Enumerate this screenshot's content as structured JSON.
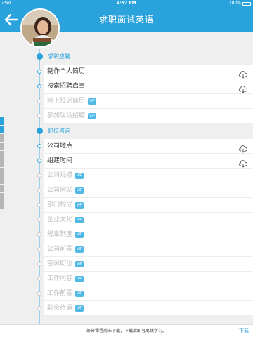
{
  "status_bar": {
    "carrier": "iPad",
    "time": "4:52 PM",
    "battery": "100%"
  },
  "header": {
    "title": "求职面试英语"
  },
  "sections": [
    {
      "label": "求职应聘",
      "items": [
        {
          "label": "制作个人简历",
          "vip": "",
          "download": true,
          "locked": false
        },
        {
          "label": "搜索招聘启事",
          "vip": "",
          "download": true,
          "locked": false
        },
        {
          "label": "网上投递简历",
          "vip": "VIP",
          "download": false,
          "locked": true
        },
        {
          "label": "参加现场招聘",
          "vip": "VIP",
          "download": false,
          "locked": true
        }
      ]
    },
    {
      "label": "职位咨询",
      "items": [
        {
          "label": "公司地点",
          "vip": "",
          "download": true,
          "locked": false
        },
        {
          "label": "组建时间",
          "vip": "",
          "download": true,
          "locked": false
        },
        {
          "label": "公司规模",
          "vip": "VIP",
          "download": false,
          "locked": true
        },
        {
          "label": "公司网站",
          "vip": "VIP",
          "download": false,
          "locked": true
        },
        {
          "label": "部门构成",
          "vip": "VIP",
          "download": false,
          "locked": true
        },
        {
          "label": "企业文化",
          "vip": "VIP",
          "download": false,
          "locked": true
        },
        {
          "label": "规章制度",
          "vip": "VIP",
          "download": false,
          "locked": true
        },
        {
          "label": "公司前景",
          "vip": "VIP",
          "download": false,
          "locked": true
        },
        {
          "label": "空闲职位",
          "vip": "VIP",
          "download": false,
          "locked": true
        },
        {
          "label": "工作内容",
          "vip": "VIP",
          "download": false,
          "locked": true
        },
        {
          "label": "工作前景",
          "vip": "VIP",
          "download": false,
          "locked": true
        },
        {
          "label": "薪资待遇",
          "vip": "VIP",
          "download": false,
          "locked": true
        }
      ]
    }
  ],
  "bottom_bar": {
    "tip": "部分课程尚未下载，下载后即可离线学习。",
    "download_label": "下载"
  },
  "colors": {
    "accent": "#2aa3dc",
    "locked_text": "#bdbdbd",
    "vip_badge": "#4fb8e6"
  }
}
